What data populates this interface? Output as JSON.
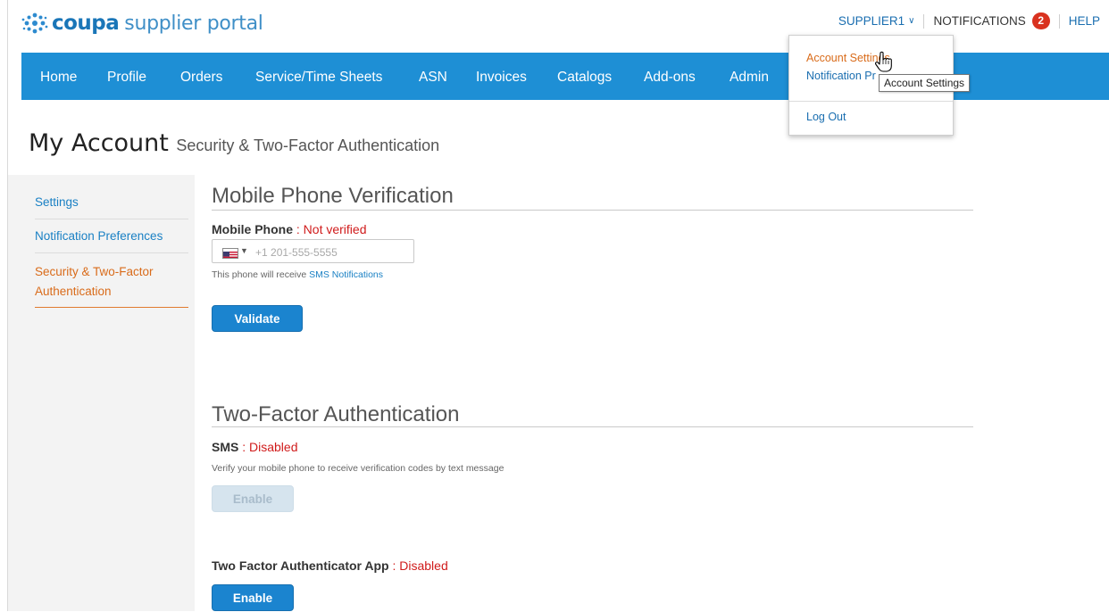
{
  "header": {
    "logo_brand": "coupa",
    "logo_subtitle": "supplier portal",
    "user_menu_label": "SUPPLIER1",
    "notifications_label": "NOTIFICATIONS",
    "notifications_count": "2",
    "help_label": "HELP"
  },
  "nav": {
    "items": [
      "Home",
      "Profile",
      "Orders",
      "Service/Time Sheets",
      "ASN",
      "Invoices",
      "Catalogs",
      "Add-ons",
      "Admin"
    ]
  },
  "user_dropdown": {
    "account_settings": "Account Settings",
    "notification_preferences": "Notification Pr",
    "log_out": "Log Out",
    "tooltip": "Account Settings"
  },
  "page": {
    "title": "My Account",
    "subtitle": "Security & Two-Factor Authentication"
  },
  "sidebar": {
    "items": [
      {
        "label": "Settings"
      },
      {
        "label": "Notification Preferences"
      },
      {
        "label": "Security & Two-Factor Authentication"
      }
    ]
  },
  "mobile_verification": {
    "heading": "Mobile Phone Verification",
    "field_label": "Mobile Phone",
    "separator": " : ",
    "status": "Not verified",
    "phone_placeholder": "+1 201-555-5555",
    "phone_value": "",
    "help_prefix": "This phone will receive ",
    "help_link": "SMS Notifications",
    "validate_button": "Validate"
  },
  "two_factor": {
    "heading": "Two-Factor Authentication",
    "sms_label": "SMS",
    "separator": " : ",
    "sms_status": "Disabled",
    "sms_help": "Verify your mobile phone to receive verification codes by text message",
    "sms_enable_button": "Enable",
    "app_label": "Two Factor Authenticator App",
    "app_status": "Disabled",
    "app_enable_button": "Enable"
  },
  "colors": {
    "nav_blue": "#1e8fd5",
    "brand_blue": "#1a76b8",
    "link_blue": "#1a80c4",
    "active_orange": "#d96b1a",
    "status_red": "#d01b1b",
    "badge_red": "#d9321f"
  },
  "icons": [
    "coupa-logo-icon",
    "chevron-down-icon",
    "us-flag-icon",
    "caret-down-icon",
    "hand-cursor-icon"
  ]
}
